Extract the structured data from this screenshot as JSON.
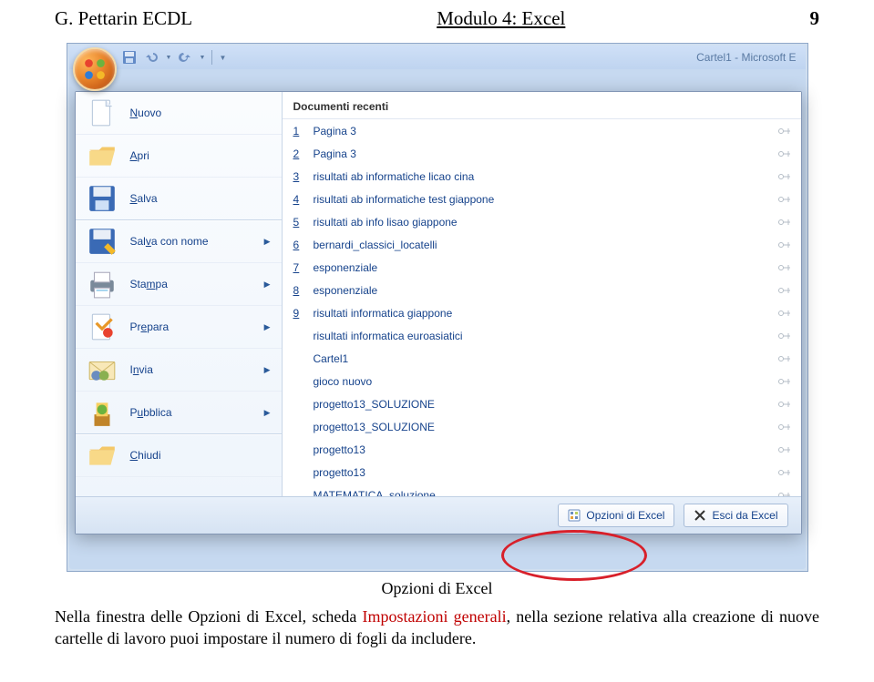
{
  "header": {
    "title": "G. Pettarin ECDL",
    "module": "Modulo 4: Excel",
    "page": "9"
  },
  "window_title": "Cartel1 - Microsoft E",
  "menu": {
    "items": [
      {
        "label": "Nuovo",
        "acc": "N",
        "icon": "new",
        "arrow": false
      },
      {
        "label": "Apri",
        "acc": "A",
        "icon": "open",
        "arrow": false
      },
      {
        "label": "Salva",
        "acc": "S",
        "icon": "save",
        "arrow": false
      },
      {
        "label": "Salva con nome",
        "acc": "v",
        "icon": "saveas",
        "arrow": true
      },
      {
        "label": "Stampa",
        "acc": "m",
        "icon": "print",
        "arrow": true
      },
      {
        "label": "Prepara",
        "acc": "e",
        "icon": "prepare",
        "arrow": true
      },
      {
        "label": "Invia",
        "acc": "n",
        "icon": "send",
        "arrow": true
      },
      {
        "label": "Pubblica",
        "acc": "u",
        "icon": "publish",
        "arrow": true
      },
      {
        "label": "Chiudi",
        "acc": "C",
        "icon": "close",
        "arrow": false
      }
    ]
  },
  "recent": {
    "header": "Documenti recenti",
    "items": [
      {
        "n": "1",
        "label": "Pagina 3"
      },
      {
        "n": "2",
        "label": "Pagina 3"
      },
      {
        "n": "3",
        "label": "risultati ab informatiche licao cina"
      },
      {
        "n": "4",
        "label": "risultati ab informatiche test giappone"
      },
      {
        "n": "5",
        "label": "risultati ab info lisao giappone"
      },
      {
        "n": "6",
        "label": "bernardi_classici_locatelli"
      },
      {
        "n": "7",
        "label": "esponenziale"
      },
      {
        "n": "8",
        "label": "esponenziale"
      },
      {
        "n": "9",
        "label": "risultati informatica giappone"
      },
      {
        "n": "",
        "label": "risultati informatica euroasiatici"
      },
      {
        "n": "",
        "label": "Cartel1"
      },
      {
        "n": "",
        "label": "gioco nuovo"
      },
      {
        "n": "",
        "label": "progetto13_SOLUZIONE"
      },
      {
        "n": "",
        "label": "progetto13_SOLUZIONE"
      },
      {
        "n": "",
        "label": "progetto13"
      },
      {
        "n": "",
        "label": "progetto13"
      },
      {
        "n": "",
        "label": "MATEMATICA_soluzione"
      }
    ]
  },
  "bottom": {
    "options": "Opzioni di Excel",
    "exit": "Esci da Excel"
  },
  "caption": "Opzioni di Excel",
  "body": {
    "t1": "Nella finestra delle Opzioni di Excel, scheda ",
    "t2": "Impostazioni generali",
    "t3": ", nella sezione relativa alla creazione di nuove cartelle di lavoro puoi impostare il numero di fogli da includere."
  }
}
